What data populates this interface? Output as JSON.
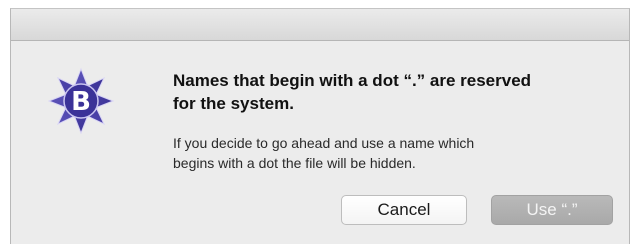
{
  "dialog": {
    "headline": "Names that begin with a dot “.” are reserved\nfor the system.",
    "message": "If you decide to go ahead and use a name which\nbegins with a dot the file will be hidden.",
    "app_icon": "bbedit-b-icon",
    "buttons": {
      "cancel_label": "Cancel",
      "confirm_label": "Use “.”"
    }
  },
  "colors": {
    "icon_star": "#4a3fa8",
    "icon_letter": "#ffffff",
    "dialog_bg": "#ececec",
    "confirm_button_bg": "#b0b0b0"
  }
}
